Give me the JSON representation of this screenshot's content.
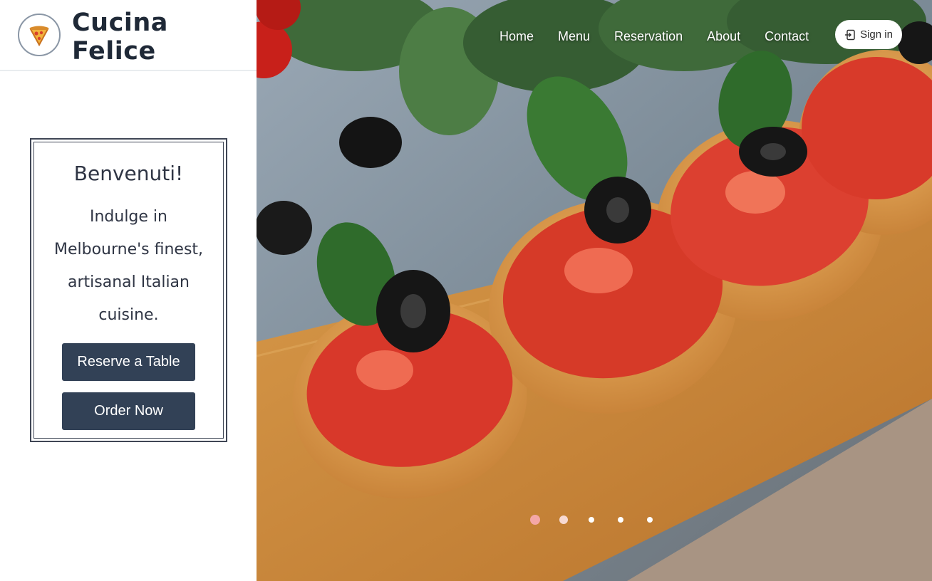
{
  "brand": {
    "name_line1": "Cucina",
    "name_line2": "Felice",
    "logo_icon": "pizza-slice-icon"
  },
  "welcome": {
    "title": "Benvenuti!",
    "text": "Indulge in Melbourne's finest, artisanal Italian cuisine.",
    "reserve_label": "Reserve a Table",
    "order_label": "Order Now"
  },
  "nav": {
    "items": [
      "Home",
      "Menu",
      "Reservation",
      "About",
      "Contact"
    ],
    "signin_label": "Sign in",
    "signin_icon": "sign-in-icon"
  },
  "carousel": {
    "slide_count": 5,
    "active_index": 0
  },
  "colors": {
    "button_bg": "#324156",
    "active_dot": "#f4a7a7",
    "text_dark": "#2f3544"
  }
}
